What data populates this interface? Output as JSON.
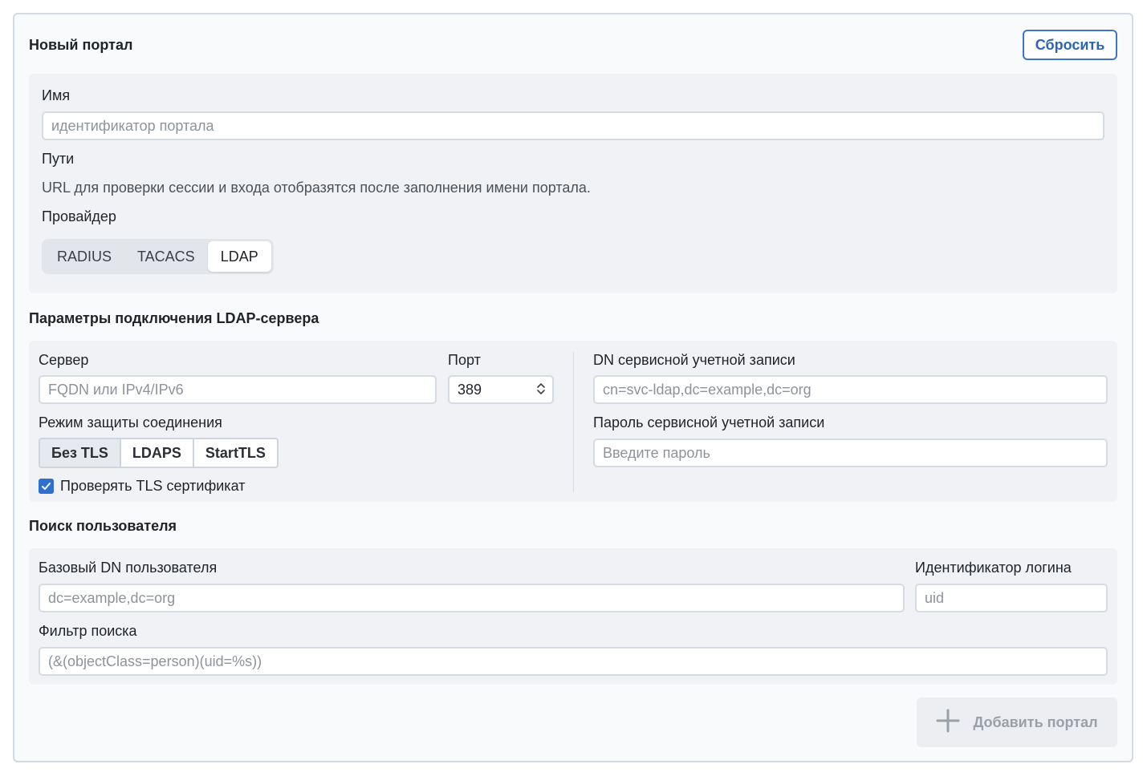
{
  "header": {
    "title": "Новый портал",
    "reset_label": "Сбросить"
  },
  "portal": {
    "name_label": "Имя",
    "name_placeholder": "идентификатор портала",
    "paths_label": "Пути",
    "paths_hint": "URL для проверки сессии и входа отобразятся после заполнения имени портала.",
    "provider_label": "Провайдер",
    "providers": [
      {
        "label": "RADIUS",
        "selected": false
      },
      {
        "label": "TACACS",
        "selected": false
      },
      {
        "label": "LDAP",
        "selected": true
      }
    ]
  },
  "ldap": {
    "section_title": "Параметры подключения LDAP-сервера",
    "server_label": "Сервер",
    "server_placeholder": "FQDN или IPv4/IPv6",
    "port_label": "Порт",
    "port_value": "389",
    "tls_mode_label": "Режим защиты соединения",
    "tls_modes": [
      {
        "label": "Без TLS",
        "selected": true
      },
      {
        "label": "LDAPS",
        "selected": false
      },
      {
        "label": "StartTLS",
        "selected": false
      }
    ],
    "verify_tls_label": "Проверять TLS сертификат",
    "verify_tls_checked": true,
    "bind_dn_label": "DN сервисной учетной записи",
    "bind_dn_placeholder": "cn=svc-ldap,dc=example,dc=org",
    "bind_password_label": "Пароль сервисной учетной записи",
    "bind_password_placeholder": "Введите пароль"
  },
  "user_search": {
    "section_title": "Поиск пользователя",
    "base_dn_label": "Базовый DN пользователя",
    "base_dn_placeholder": "dc=example,dc=org",
    "login_attr_label": "Идентификатор логина",
    "login_attr_placeholder": "uid",
    "filter_label": "Фильтр поиска",
    "filter_placeholder": "(&(objectClass=person)(uid=%s))"
  },
  "footer": {
    "add_label": "Добавить портал",
    "add_icon": "plus-icon"
  },
  "colors": {
    "accent": "#2f6fd0",
    "reset_border": "#3d76c6",
    "panel_bg": "#f0f2f5"
  }
}
